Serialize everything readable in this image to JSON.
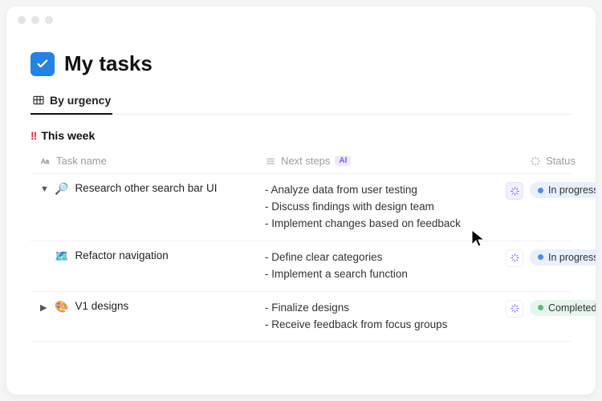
{
  "page": {
    "title": "My tasks"
  },
  "tabs": {
    "active": {
      "label": "By urgency"
    }
  },
  "group": {
    "label": "This week",
    "marker": "!!"
  },
  "columns": {
    "task": "Task name",
    "next": "Next steps",
    "ai_badge": "AI",
    "status": "Status"
  },
  "rows": [
    {
      "expanded": true,
      "emoji": "🔎",
      "name": "Research other search bar UI",
      "steps": [
        "Analyze data from user testing",
        "Discuss findings with design team",
        "Implement changes based on feedback"
      ],
      "status": {
        "label": "In progress",
        "tone": "blue"
      },
      "ai_hover": true
    },
    {
      "expanded": null,
      "emoji": "🗺️",
      "name": "Refactor navigation",
      "steps": [
        "Define clear categories",
        "Implement a search function"
      ],
      "status": {
        "label": "In progress",
        "tone": "blue"
      },
      "ai_hover": false
    },
    {
      "expanded": false,
      "emoji": "🎨",
      "name": "V1 designs",
      "steps": [
        "Finalize designs",
        "Receive feedback from focus groups"
      ],
      "status": {
        "label": "Completed",
        "tone": "green"
      },
      "ai_hover": false
    }
  ]
}
